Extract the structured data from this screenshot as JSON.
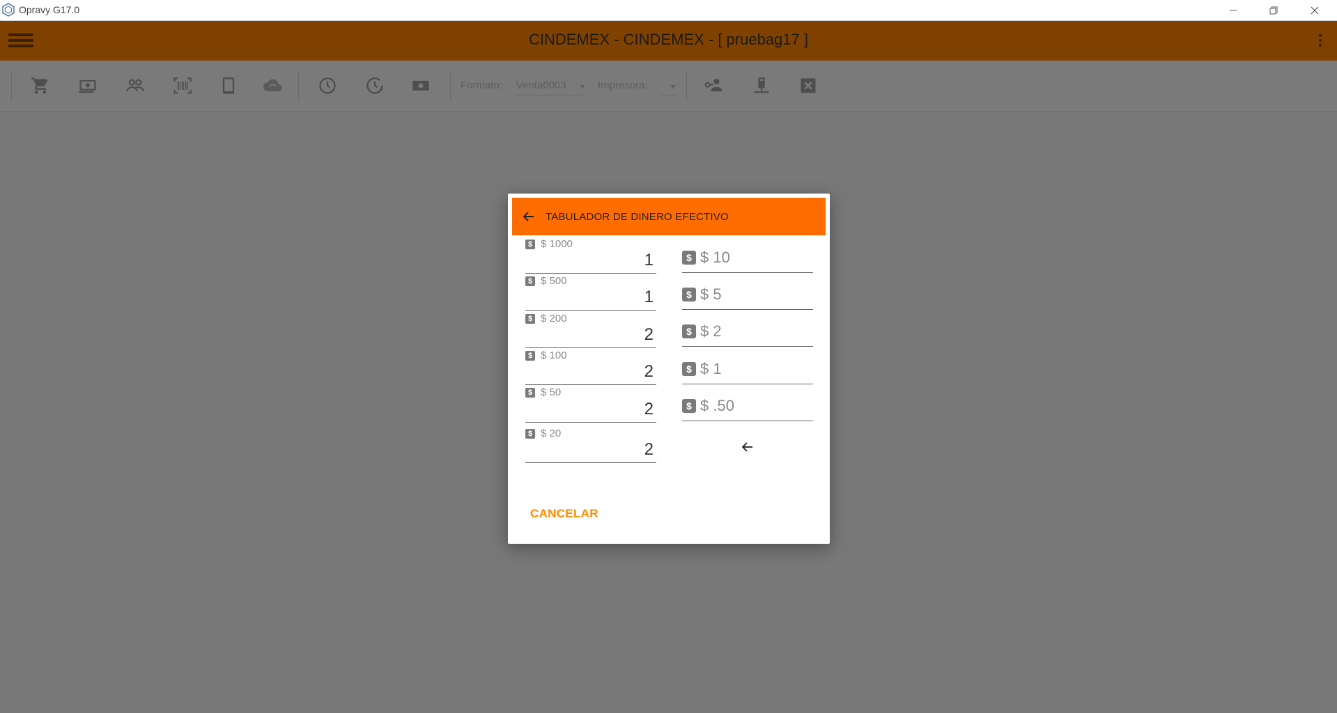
{
  "window": {
    "title": "Opravy G17.0"
  },
  "header": {
    "title": "CINDEMEX -  CINDEMEX - [ pruebag17 ]"
  },
  "toolbar": {
    "icons": [
      "cart-icon",
      "cash-icon",
      "users-icon",
      "barcode-icon",
      "tablet-icon",
      "cloud-sync-icon",
      "clock-icon",
      "clock-history-icon",
      "money-icon",
      "person-key-icon",
      "printer-server-icon",
      "close-box-icon"
    ],
    "formato_label": "Formato:",
    "formato_value": "Venta0003",
    "impresora_label": "Impresora:",
    "impresora_value": ""
  },
  "dialog": {
    "title": "TABULADOR DE DINERO EFECTIVO",
    "left_fields": [
      {
        "label": "$ 1000",
        "value": "1"
      },
      {
        "label": "$ 500",
        "value": "1"
      },
      {
        "label": "$ 200",
        "value": "2"
      },
      {
        "label": "$ 100",
        "value": "2"
      },
      {
        "label": "$ 50",
        "value": "2"
      },
      {
        "label": "$ 20",
        "value": "2"
      }
    ],
    "right_fields": [
      {
        "placeholder": "$ 10",
        "value": ""
      },
      {
        "placeholder": "$ 5",
        "value": ""
      },
      {
        "placeholder": "$ 2",
        "value": ""
      },
      {
        "placeholder": "$ 1",
        "value": ""
      },
      {
        "placeholder": "$ .50",
        "value": ""
      }
    ],
    "dollar_glyph": "$",
    "cancel_label": "CANCELAR"
  },
  "colors": {
    "dialog_header": "#ff6d00",
    "cancel_text": "#ff8a00",
    "app_header_dimmed": "#7f4100",
    "overlay_bg": "#787878"
  }
}
